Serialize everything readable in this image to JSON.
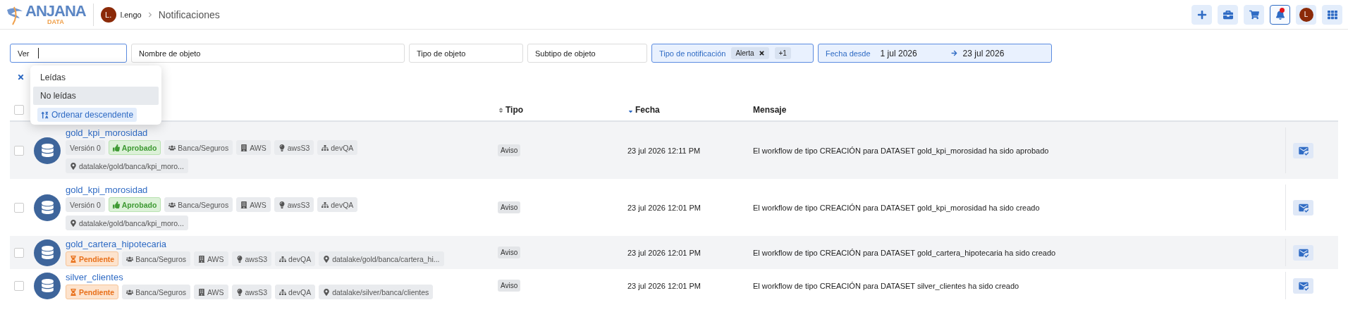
{
  "header": {
    "logo": {
      "name": "ANJANA",
      "sub": "DATA"
    },
    "user_initial": "L.",
    "user": "l.engo",
    "page": "Notificaciones",
    "actions": [
      {
        "kind": "add",
        "selected": false
      },
      {
        "kind": "briefcase",
        "selected": false
      },
      {
        "kind": "cart",
        "selected": false
      },
      {
        "kind": "bell",
        "selected": true,
        "badge": true
      },
      {
        "kind": "avatar",
        "text": "L",
        "selected": false
      },
      {
        "kind": "apps",
        "selected": false
      }
    ]
  },
  "filters": [
    {
      "kind": "select",
      "label": "Ver",
      "focused": true
    },
    {
      "kind": "text",
      "label": "Nombre de objeto"
    },
    {
      "kind": "text",
      "label": "Tipo de objeto"
    },
    {
      "kind": "text",
      "label": "Subtipo de objeto"
    },
    {
      "kind": "chips",
      "label": "Tipo de notificación",
      "chips": [
        "Alerta"
      ],
      "more": "+1"
    },
    {
      "kind": "daterange",
      "label": "Fecha desde",
      "from": "1 jul 2026",
      "to": "23 jul 2026"
    }
  ],
  "dropdown": {
    "options": [
      {
        "label": "Leídas",
        "selected": false
      },
      {
        "label": "No leídas",
        "selected": true
      }
    ],
    "sort_action": "Ordenar descendente"
  },
  "table": {
    "select_all_checked": false,
    "columns": [
      {
        "label": "Tipo",
        "sortable": true,
        "sorted": false
      },
      {
        "label": "Fecha",
        "sortable": true,
        "sorted": true
      },
      {
        "label": "Mensaje",
        "sortable": false
      }
    ],
    "rows": [
      {
        "checked": false,
        "name": "gold_kpi_morosidad",
        "tags": [
          {
            "kind": "version",
            "text": "Versión 0"
          },
          {
            "kind": "approved",
            "text": "Aprobado"
          },
          {
            "kind": "domain",
            "text": "Banca/Seguros"
          },
          {
            "kind": "provider",
            "text": "AWS"
          },
          {
            "kind": "tech",
            "text": "awsS3"
          },
          {
            "kind": "env",
            "text": "devQA"
          },
          {
            "kind": "path",
            "text": "datalake/gold/banca/kpi_moro..."
          }
        ],
        "type": "Aviso",
        "date": "23 jul 2026 12:11 PM",
        "message": "El workflow de tipo CREACIÓN para DATASET gold_kpi_morosidad ha sido aprobado"
      },
      {
        "checked": false,
        "name": "gold_kpi_morosidad",
        "tags": [
          {
            "kind": "version",
            "text": "Versión 0"
          },
          {
            "kind": "approved",
            "text": "Aprobado"
          },
          {
            "kind": "domain",
            "text": "Banca/Seguros"
          },
          {
            "kind": "provider",
            "text": "AWS"
          },
          {
            "kind": "tech",
            "text": "awsS3"
          },
          {
            "kind": "env",
            "text": "devQA"
          },
          {
            "kind": "path",
            "text": "datalake/gold/banca/kpi_moro..."
          }
        ],
        "type": "Aviso",
        "date": "23 jul 2026 12:01 PM",
        "message": "El workflow de tipo CREACIÓN para DATASET gold_kpi_morosidad ha sido creado"
      },
      {
        "checked": false,
        "name": "gold_cartera_hipotecaria",
        "tags": [
          {
            "kind": "pending",
            "text": "Pendiente"
          },
          {
            "kind": "domain",
            "text": "Banca/Seguros"
          },
          {
            "kind": "provider",
            "text": "AWS"
          },
          {
            "kind": "tech",
            "text": "awsS3"
          },
          {
            "kind": "env",
            "text": "devQA"
          },
          {
            "kind": "path",
            "text": "datalake/gold/banca/cartera_hi..."
          }
        ],
        "type": "Aviso",
        "date": "23 jul 2026 12:01 PM",
        "message": "El workflow de tipo CREACIÓN para DATASET gold_cartera_hipotecaria ha sido creado"
      },
      {
        "checked": false,
        "name": "silver_clientes",
        "tags": [
          {
            "kind": "pending",
            "text": "Pendiente"
          },
          {
            "kind": "domain",
            "text": "Banca/Seguros"
          },
          {
            "kind": "provider",
            "text": "AWS"
          },
          {
            "kind": "tech",
            "text": "awsS3"
          },
          {
            "kind": "env",
            "text": "devQA"
          },
          {
            "kind": "path",
            "text": "datalake/silver/banca/clientes"
          }
        ],
        "type": "Aviso",
        "date": "23 jul 2026 12:01 PM",
        "message": "El workflow de tipo CREACIÓN para DATASET silver_clientes ha sido creado"
      }
    ]
  }
}
